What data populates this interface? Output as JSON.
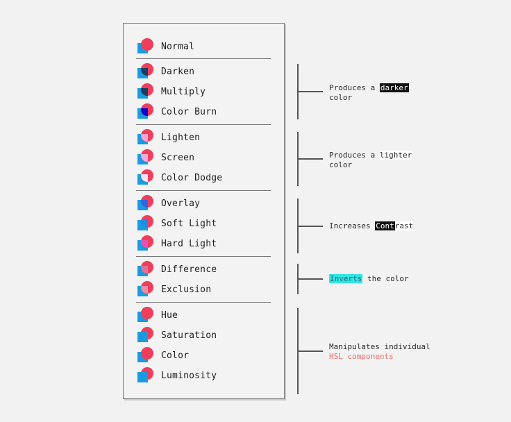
{
  "colors": {
    "square": "#1b9ae0",
    "circle": "#ef3e5c",
    "background": "#f2f2f2",
    "panel_border": "#7b7b7b",
    "bracket": "#555555",
    "highlight_black": "#111111",
    "highlight_cyan": "#2ee6e6",
    "hsl_red": "#ee6a6a"
  },
  "groups": [
    {
      "modes": [
        {
          "label": "Normal",
          "overlap": "#ef3e5c"
        }
      ]
    },
    {
      "modes": [
        {
          "label": "Darken",
          "overlap": "#1b3f66"
        },
        {
          "label": "Multiply",
          "overlap": "#173e63"
        },
        {
          "label": "Color Burn",
          "overlap": "#0a00c8"
        }
      ],
      "description": {
        "line1_prefix": "Produces a ",
        "line1_highlight": "darker",
        "line2": "color"
      }
    },
    {
      "modes": [
        {
          "label": "Lighten",
          "overlap": "#f5a3d6"
        },
        {
          "label": "Screen",
          "overlap": "#f4a8dc"
        },
        {
          "label": "Color Dodge",
          "overlap": "#fbe0f2"
        }
      ],
      "description": {
        "line1_prefix": "Produces a ",
        "line1_highlight": "lighter",
        "line2": "color"
      }
    },
    {
      "modes": [
        {
          "label": "Overlay",
          "overlap": "#2a6ae0"
        },
        {
          "label": "Soft Light",
          "overlap": "#1b8fe6"
        },
        {
          "label": "Hard Light",
          "overlap": "#e851b4"
        }
      ],
      "description": {
        "prefix": "Increases ",
        "highlight_black": "Cont",
        "highlight_white": "rast"
      }
    },
    {
      "modes": [
        {
          "label": "Difference",
          "overlap": "#e07394"
        },
        {
          "label": "Exclusion",
          "overlap": "#e88ea0"
        }
      ],
      "description": {
        "highlight": "Inverts",
        "suffix": " the color"
      }
    },
    {
      "modes": [
        {
          "label": "Hue",
          "overlap": "#ef3e5c"
        },
        {
          "label": "Saturation",
          "overlap": "#1b9ae0"
        },
        {
          "label": "Color",
          "overlap": "#ef3e5c"
        },
        {
          "label": "Luminosity",
          "overlap": "#1b9ae0"
        }
      ],
      "description": {
        "line1": "Manipulates individual",
        "line2_red": "HSL components"
      }
    }
  ]
}
